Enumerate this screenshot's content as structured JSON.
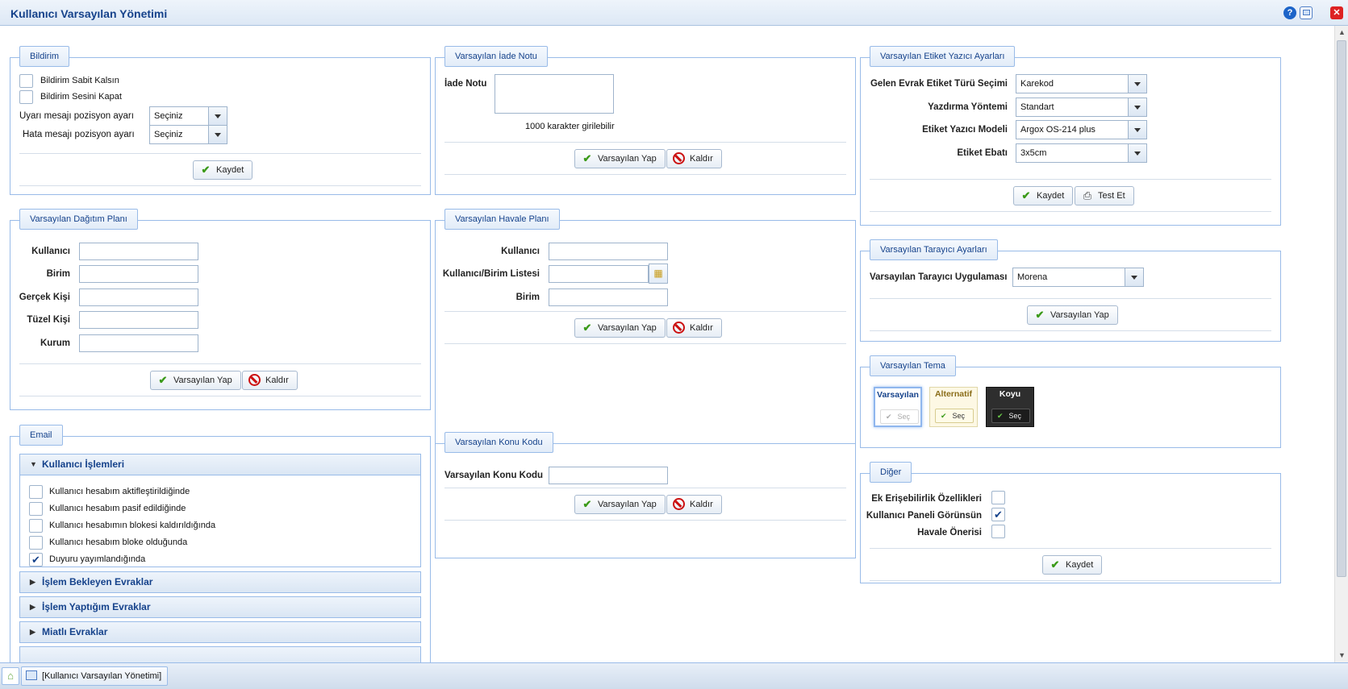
{
  "window": {
    "title": "Kullanıcı Varsayılan Yönetimi",
    "help_glyph": "?",
    "close_glyph": "✕"
  },
  "common": {
    "save": "Kaydet",
    "set_default": "Varsayılan Yap",
    "remove": "Kaldır",
    "test": "Test Et",
    "select": "Seç"
  },
  "bildirim": {
    "legend": "Bildirim",
    "sabit": "Bildirim Sabit Kalsın",
    "ses": "Bildirim Sesini Kapat",
    "uyari_label": "Uyarı mesajı pozisyon ayarı",
    "uyari_value": "Seçiniz",
    "hata_label": "Hata mesajı pozisyon ayarı",
    "hata_value": "Seçiniz"
  },
  "dagitim": {
    "legend": "Varsayılan Dağıtım Planı",
    "kullanici": "Kullanıcı",
    "birim": "Birim",
    "gercek": "Gerçek Kişi",
    "tuzel": "Tüzel Kişi",
    "kurum": "Kurum"
  },
  "email": {
    "legend": "Email",
    "section1": "Kullanıcı İşlemleri",
    "items": [
      "Kullanıcı hesabım aktifleştirildiğinde",
      "Kullanıcı hesabım pasif edildiğinde",
      "Kullanıcı hesabımın blokesi kaldırıldığında",
      "Kullanıcı hesabım bloke olduğunda",
      "Duyuru yayımlandığında"
    ],
    "checked_mark": "✔",
    "section2": "İşlem Bekleyen Evraklar",
    "section3": "İşlem Yaptığım Evraklar",
    "section4": "Miatlı Evraklar"
  },
  "iade": {
    "legend": "Varsayılan İade Notu",
    "label": "İade Notu",
    "hint": "1000 karakter girilebilir"
  },
  "havale": {
    "legend": "Varsayılan Havale Planı",
    "kullanici": "Kullanıcı",
    "liste": "Kullanıcı/Birim Listesi",
    "birim": "Birim"
  },
  "konu": {
    "legend": "Varsayılan Konu Kodu",
    "label": "Varsayılan Konu Kodu"
  },
  "etiket": {
    "legend": "Varsayılan Etiket Yazıcı Ayarları",
    "tur_label": "Gelen Evrak Etiket Türü Seçimi",
    "tur_value": "Karekod",
    "yontem_label": "Yazdırma Yöntemi",
    "yontem_value": "Standart",
    "model_label": "Etiket Yazıcı Modeli",
    "model_value": "Argox OS-214 plus",
    "ebat_label": "Etiket Ebatı",
    "ebat_value": "3x5cm"
  },
  "tarayici": {
    "legend": "Varsayılan Tarayıcı Ayarları",
    "label": "Varsayılan Tarayıcı Uygulaması",
    "value": "Morena"
  },
  "tema": {
    "legend": "Varsayılan Tema",
    "themes": [
      "Varsayılan",
      "Alternatif",
      "Koyu"
    ]
  },
  "diger": {
    "legend": "Diğer",
    "erisim": "Ek Erişebilirlik Özellikleri",
    "panel": "Kullanıcı Paneli Görünsün",
    "havale": "Havale Önerisi"
  },
  "taskbar": {
    "item": "[Kullanıcı Varsayılan Yönetimi]"
  }
}
